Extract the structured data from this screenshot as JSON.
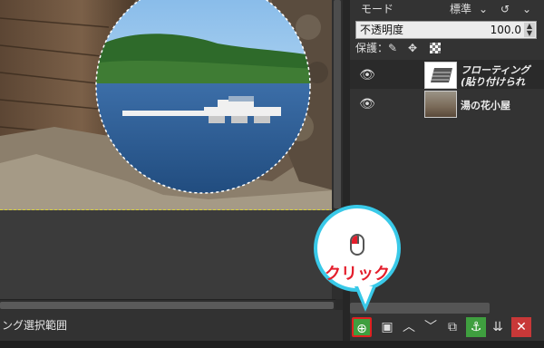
{
  "status_bar": {
    "text": "ング選択範囲"
  },
  "layers_panel": {
    "mode_label": "モード",
    "mode_value": "標準",
    "opacity_label": "不透明度",
    "opacity_value": "100.0",
    "lock_label": "保護：",
    "layers": [
      {
        "name_line1": "フローティング",
        "name_line2": "(貼り付けられ"
      },
      {
        "name": "湯の花小屋"
      }
    ]
  },
  "callout": {
    "text": "クリック"
  },
  "icons": {
    "eye": "eye-icon",
    "new_layer": "new-layer-icon",
    "anchor": "anchor-icon",
    "delete": "delete-icon"
  },
  "colors": {
    "callout_border": "#39c9e8",
    "callout_text": "#e41e2c",
    "accent_green": "#3f9f3f",
    "delete_red": "#c83838"
  }
}
